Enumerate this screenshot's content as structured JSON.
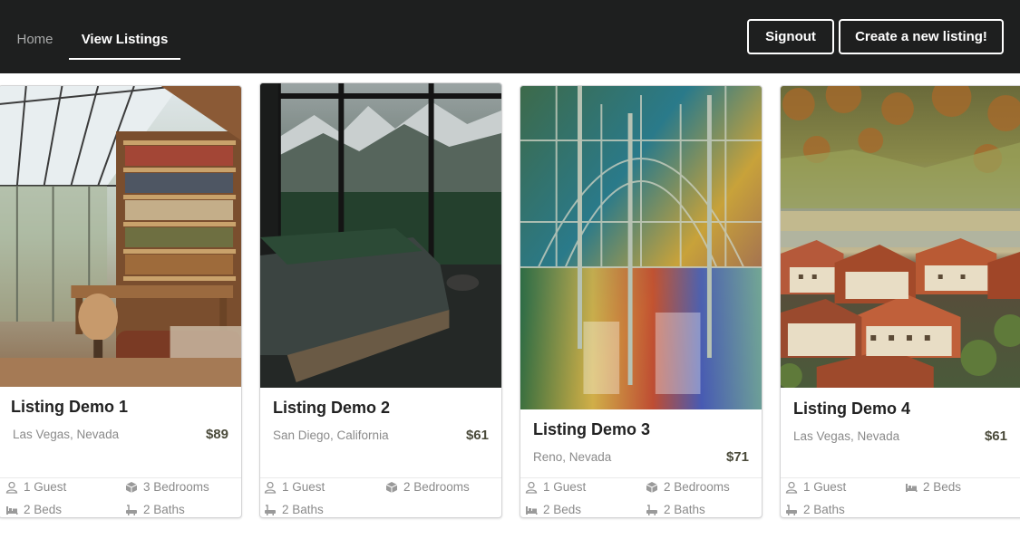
{
  "nav": {
    "home_label": "Home",
    "listings_label": "View Listings",
    "signout_label": "Signout",
    "create_label": "Create a new listing!"
  },
  "listings": [
    {
      "title": "Listing Demo 1",
      "location": "Las Vegas, Nevada",
      "price": "$89",
      "image_subject": "library room with glass roof",
      "features": [
        "1 Guest",
        "3 Bedrooms",
        "2 Beds",
        "2 Baths"
      ]
    },
    {
      "title": "Listing Demo 2",
      "location": "San Diego, California",
      "price": "$61",
      "image_subject": "bedroom with mountain view",
      "features": [
        "1 Guest",
        "2 Bedrooms",
        "2 Baths"
      ]
    },
    {
      "title": "Listing Demo 3",
      "location": "Reno, Nevada",
      "price": "$71",
      "image_subject": "stained glass palace interior",
      "features": [
        "1 Guest",
        "2 Bedrooms",
        "2 Beds",
        "2 Baths"
      ]
    },
    {
      "title": "Listing Demo 4",
      "location": "Las Vegas, Nevada",
      "price": "$61",
      "image_subject": "lakeside alpine village",
      "features": [
        "1 Guest",
        "2 Beds",
        "2 Baths"
      ]
    }
  ],
  "icons": {
    "guest": "user-icon",
    "bedrooms": "cube-icon",
    "beds": "bed-icon",
    "baths": "bath-icon"
  },
  "colors": {
    "topbar": "#1e1f1f",
    "price": "#4a4a3a",
    "muted_text": "#8a8a8a"
  }
}
